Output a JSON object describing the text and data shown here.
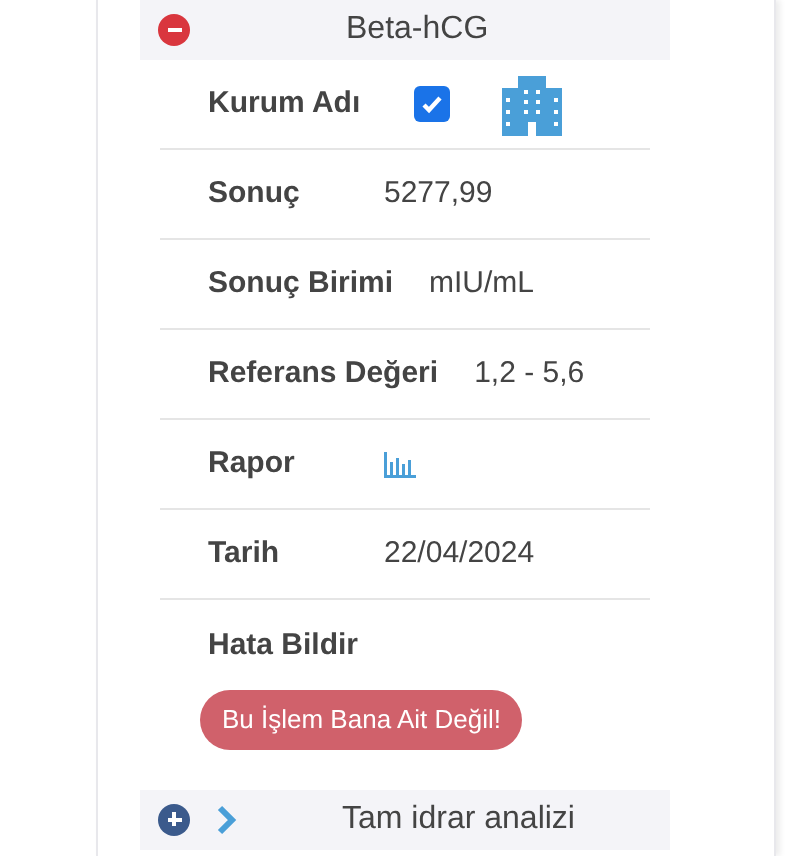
{
  "tests": [
    {
      "name": "Beta-hCG",
      "expanded": true,
      "fields": [
        {
          "label": "Kurum Adı",
          "kind": "institution",
          "checked": true
        },
        {
          "label": "Sonuç",
          "kind": "text",
          "value": "5277,99"
        },
        {
          "label": "Sonuç Birimi",
          "kind": "text",
          "value": "mIU/mL"
        },
        {
          "label": "Referans Değeri",
          "kind": "text",
          "value": "1,2 - 5,6"
        },
        {
          "label": "Rapor",
          "kind": "report"
        },
        {
          "label": "Tarih",
          "kind": "text",
          "value": "22/04/2024"
        }
      ],
      "error_report": {
        "label": "Hata Bildir",
        "button": "Bu İşlem Bana Ait Değil!"
      }
    },
    {
      "name": "Tam idrar analizi",
      "expanded": false
    }
  ]
}
